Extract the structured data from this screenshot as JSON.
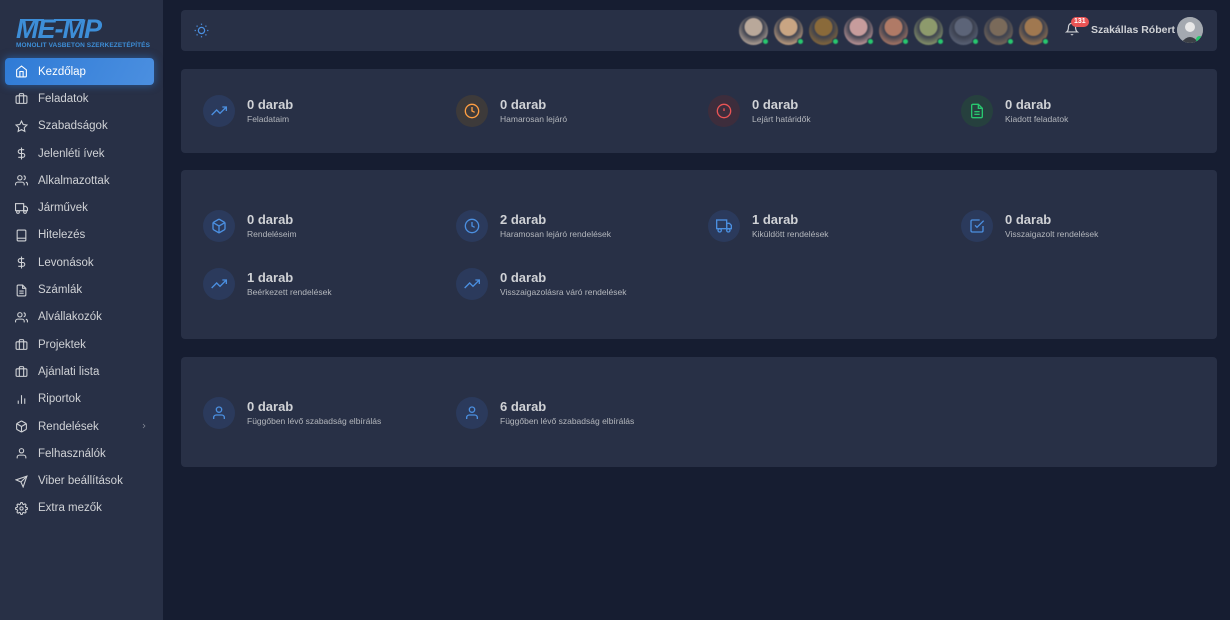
{
  "sidebar": {
    "logo_text": "MONOLIT VASBETON SZERKEZETÉPÍTÉS",
    "items": [
      {
        "label": "Kezdőlap",
        "icon": "home-icon",
        "active": true
      },
      {
        "label": "Feladatok",
        "icon": "briefcase-icon"
      },
      {
        "label": "Szabadságok",
        "icon": "star-icon"
      },
      {
        "label": "Jelenléti ívek",
        "icon": "dollar-icon"
      },
      {
        "label": "Alkalmazottak",
        "icon": "users-icon"
      },
      {
        "label": "Járművek",
        "icon": "truck-icon"
      },
      {
        "label": "Hitelezés",
        "icon": "tablet-icon"
      },
      {
        "label": "Levonások",
        "icon": "dollar-icon"
      },
      {
        "label": "Számlák",
        "icon": "file-icon"
      },
      {
        "label": "Alvállakozók",
        "icon": "users-icon"
      },
      {
        "label": "Projektek",
        "icon": "briefcase-icon"
      },
      {
        "label": "Ajánlati lista",
        "icon": "briefcase-icon"
      },
      {
        "label": "Riportok",
        "icon": "bar-chart-icon"
      },
      {
        "label": "Rendelések",
        "icon": "box-icon",
        "has_submenu": true
      },
      {
        "label": "Felhasználók",
        "icon": "user-icon"
      },
      {
        "label": "Viber beállítások",
        "icon": "send-icon"
      },
      {
        "label": "Extra mezők",
        "icon": "settings-icon"
      }
    ]
  },
  "header": {
    "notification_count": "131",
    "user_name": "Szakállas Róbert",
    "avatar_colors": [
      "#b9a89a",
      "#c9a583",
      "#8a6a3a",
      "#c79c9c",
      "#b07a66",
      "#8d9a6c",
      "#5c6478",
      "#7a6a5a",
      "#a07850"
    ]
  },
  "cards": [
    {
      "stats": [
        {
          "value": "0 darab",
          "label": "Feladataim",
          "icon": "trending-up-icon",
          "color": "#4b8fe0"
        },
        {
          "value": "0 darab",
          "label": "Hamarosan lejáró",
          "icon": "clock-icon",
          "color": "#ff9f43"
        },
        {
          "value": "0 darab",
          "label": "Lejárt határidők",
          "icon": "alert-circle-icon",
          "color": "#ea5455"
        },
        {
          "value": "0 darab",
          "label": "Kiadott feladatok",
          "icon": "file-text-icon",
          "color": "#28c76f"
        }
      ]
    },
    {
      "stats": [
        {
          "value": "0 darab",
          "label": "Rendeléseim",
          "icon": "box-icon",
          "color": "#4b8fe0"
        },
        {
          "value": "2 darab",
          "label": "Haramosan lejáró rendelések",
          "icon": "clock-icon",
          "color": "#4b8fe0"
        },
        {
          "value": "1 darab",
          "label": "Kiküldött rendelések",
          "icon": "truck-icon",
          "color": "#4b8fe0"
        },
        {
          "value": "0 darab",
          "label": "Visszaigazolt rendelések",
          "icon": "check-square-icon",
          "color": "#4b8fe0"
        },
        {
          "value": "1 darab",
          "label": "Beérkezett rendelések",
          "icon": "trending-up-icon",
          "color": "#4b8fe0"
        },
        {
          "value": "0 darab",
          "label": "Visszaigazolásra váró rendelések",
          "icon": "trending-up-icon",
          "color": "#4b8fe0"
        }
      ]
    },
    {
      "stats": [
        {
          "value": "0 darab",
          "label": "Függőben lévő szabadság elbírálás",
          "icon": "user-icon",
          "color": "#4b8fe0"
        },
        {
          "value": "6 darab",
          "label": "Függőben lévő szabadság elbírálás",
          "icon": "user-icon",
          "color": "#4b8fe0"
        }
      ]
    }
  ]
}
